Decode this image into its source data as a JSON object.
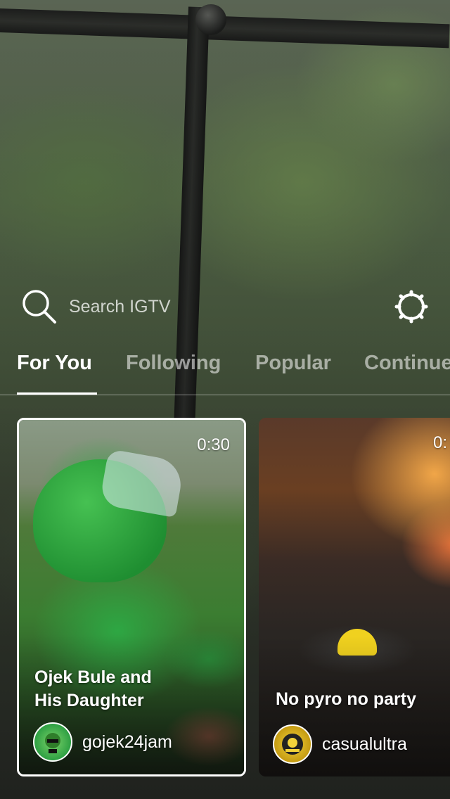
{
  "search": {
    "placeholder": "Search IGTV"
  },
  "tabs": [
    {
      "label": "For You",
      "active": true
    },
    {
      "label": "Following",
      "active": false
    },
    {
      "label": "Popular",
      "active": false
    },
    {
      "label": "Continue",
      "active": false
    }
  ],
  "videos": [
    {
      "duration": "0:30",
      "title_line1": "Ojek Bule and",
      "title_line2": "His Daughter",
      "channel": "gojek24jam",
      "selected": true
    },
    {
      "duration": "0:",
      "title_line1": "No pyro no party",
      "channel": "casualultra",
      "selected": false
    }
  ],
  "colors": {
    "accent": "#ffffff",
    "inactive_tab": "rgba(255,255,255,0.55)"
  },
  "icons": {
    "search": "search-icon",
    "settings": "gear-icon"
  }
}
